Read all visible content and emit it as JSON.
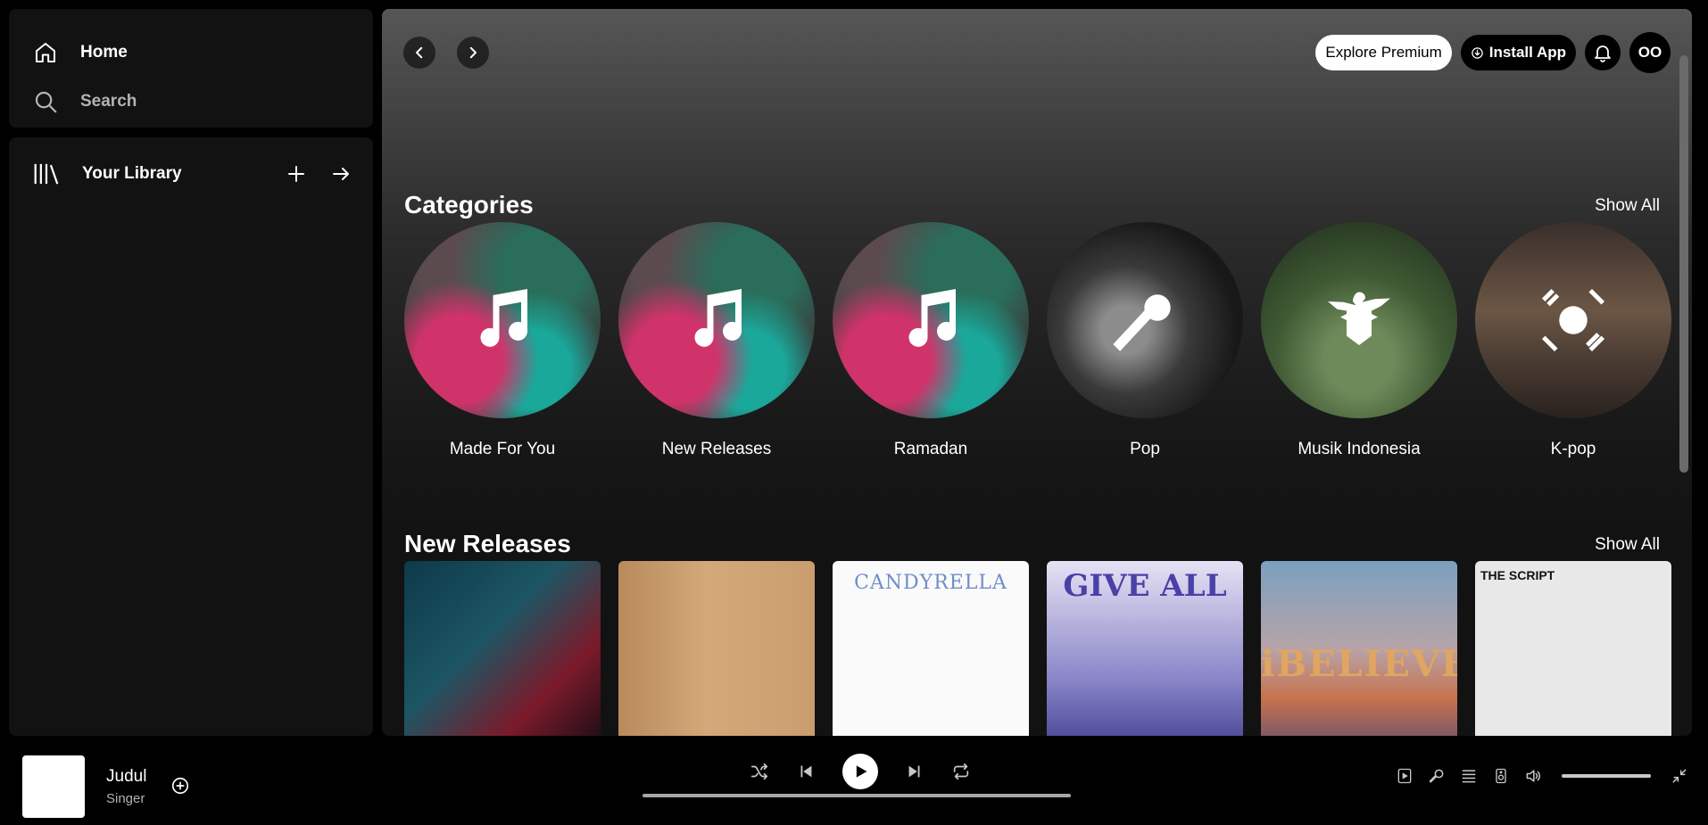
{
  "sidebar": {
    "home_label": "Home",
    "search_label": "Search",
    "library_label": "Your Library"
  },
  "topbar": {
    "explore_premium": "Explore Premium",
    "install_app": "Install App",
    "avatar_initials": "OO"
  },
  "categories": {
    "title": "Categories",
    "show_all": "Show All",
    "items": [
      {
        "label": "Made For You",
        "icon": "music-note-icon"
      },
      {
        "label": "New Releases",
        "icon": "music-note-icon"
      },
      {
        "label": "Ramadan",
        "icon": "music-note-icon"
      },
      {
        "label": "Pop",
        "icon": "microphone-icon"
      },
      {
        "label": "Musik Indonesia",
        "icon": "garuda-icon"
      },
      {
        "label": "K-pop",
        "icon": "taegeuk-icon"
      }
    ]
  },
  "new_releases": {
    "title": "New Releases",
    "show_all": "Show All",
    "albums": [
      {
        "cover_text": ""
      },
      {
        "cover_text": ""
      },
      {
        "cover_text": "CANDYRELLA"
      },
      {
        "cover_text": "GIVE ALL"
      },
      {
        "cover_text": "iBELIEVE"
      },
      {
        "cover_text": "THE SCRIPT"
      }
    ]
  },
  "player": {
    "track_title": "Judul",
    "track_artist": "Singer"
  },
  "colors": {
    "background": "#000000",
    "panel": "#121212",
    "text_secondary": "#b3b3b3"
  }
}
